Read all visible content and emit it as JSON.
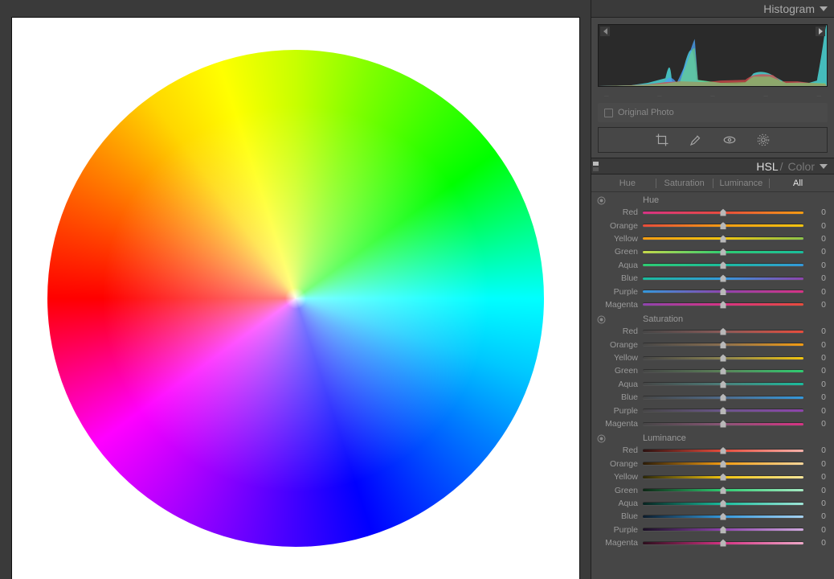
{
  "panels": {
    "histogram": {
      "title": "Histogram",
      "original_photo": "Original Photo",
      "ticks": [
        "–",
        "–",
        "–",
        "–",
        "–"
      ]
    },
    "hsl": {
      "title_primary": "HSL",
      "title_slash": " / ",
      "title_secondary": "Color",
      "tabs": [
        "Hue",
        "Saturation",
        "Luminance",
        "All"
      ],
      "active_tab": 3,
      "groups": [
        {
          "name": "Hue",
          "sliders": [
            {
              "label": "Red",
              "value": 0,
              "gradient": [
                "#d63384",
                "#e74c3c",
                "#f39c12"
              ]
            },
            {
              "label": "Orange",
              "value": 0,
              "gradient": [
                "#e74c3c",
                "#f39c12",
                "#f1c40f"
              ]
            },
            {
              "label": "Yellow",
              "value": 0,
              "gradient": [
                "#f39c12",
                "#f1c40f",
                "#8bc34a"
              ]
            },
            {
              "label": "Green",
              "value": 0,
              "gradient": [
                "#c6d94a",
                "#2ecc71",
                "#1abc9c"
              ]
            },
            {
              "label": "Aqua",
              "value": 0,
              "gradient": [
                "#2ecc71",
                "#1abc9c",
                "#3498db"
              ]
            },
            {
              "label": "Blue",
              "value": 0,
              "gradient": [
                "#1abc9c",
                "#3498db",
                "#8e44ad"
              ]
            },
            {
              "label": "Purple",
              "value": 0,
              "gradient": [
                "#3498db",
                "#8e44ad",
                "#d63384"
              ]
            },
            {
              "label": "Magenta",
              "value": 0,
              "gradient": [
                "#8e44ad",
                "#d63384",
                "#e74c3c"
              ]
            }
          ]
        },
        {
          "name": "Saturation",
          "sliders": [
            {
              "label": "Red",
              "value": 0,
              "gradient": [
                "#464646",
                "#8a5a58",
                "#e74c3c"
              ]
            },
            {
              "label": "Orange",
              "value": 0,
              "gradient": [
                "#464646",
                "#8a6f50",
                "#f39c12"
              ]
            },
            {
              "label": "Yellow",
              "value": 0,
              "gradient": [
                "#464646",
                "#8a8350",
                "#f1c40f"
              ]
            },
            {
              "label": "Green",
              "value": 0,
              "gradient": [
                "#464646",
                "#5a8258",
                "#2ecc71"
              ]
            },
            {
              "label": "Aqua",
              "value": 0,
              "gradient": [
                "#464646",
                "#4c7e7a",
                "#1abc9c"
              ]
            },
            {
              "label": "Blue",
              "value": 0,
              "gradient": [
                "#464646",
                "#4e6a8a",
                "#3498db"
              ]
            },
            {
              "label": "Purple",
              "value": 0,
              "gradient": [
                "#464646",
                "#6a558a",
                "#8e44ad"
              ]
            },
            {
              "label": "Magenta",
              "value": 0,
              "gradient": [
                "#464646",
                "#8a5576",
                "#d63384"
              ]
            }
          ]
        },
        {
          "name": "Luminance",
          "sliders": [
            {
              "label": "Red",
              "value": 0,
              "gradient": [
                "#2b1110",
                "#e74c3c",
                "#f6b2aa"
              ]
            },
            {
              "label": "Orange",
              "value": 0,
              "gradient": [
                "#2b1c08",
                "#f39c12",
                "#f9d69a"
              ]
            },
            {
              "label": "Yellow",
              "value": 0,
              "gradient": [
                "#2b2708",
                "#f1c40f",
                "#f8e79a"
              ]
            },
            {
              "label": "Green",
              "value": 0,
              "gradient": [
                "#0d2615",
                "#2ecc71",
                "#a6e9c3"
              ]
            },
            {
              "label": "Aqua",
              "value": 0,
              "gradient": [
                "#082320",
                "#1abc9c",
                "#9fe4d6"
              ]
            },
            {
              "label": "Blue",
              "value": 0,
              "gradient": [
                "#0c1c2b",
                "#3498db",
                "#a6d1ef"
              ]
            },
            {
              "label": "Purple",
              "value": 0,
              "gradient": [
                "#1a0f24",
                "#8e44ad",
                "#cfa9dd"
              ]
            },
            {
              "label": "Magenta",
              "value": 0,
              "gradient": [
                "#2b0e1c",
                "#d63384",
                "#eea9c8"
              ]
            }
          ]
        }
      ]
    }
  }
}
